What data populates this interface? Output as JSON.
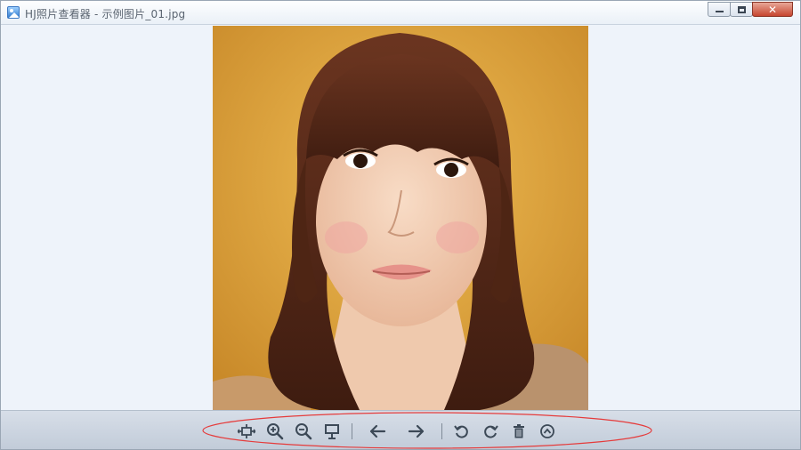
{
  "window": {
    "title": "HJ照片查看器 - 示例图片_01.jpg",
    "close_glyph": "✕"
  },
  "image": {
    "description_icon": "photo-icon"
  },
  "toolbar": {
    "tools": [
      {
        "name": "fit-window-icon"
      },
      {
        "name": "zoom-in-icon"
      },
      {
        "name": "zoom-out-icon"
      },
      {
        "name": "slideshow-icon"
      },
      {
        "name": "previous-icon"
      },
      {
        "name": "next-icon"
      },
      {
        "name": "rotate-left-icon"
      },
      {
        "name": "rotate-right-icon"
      },
      {
        "name": "delete-icon"
      },
      {
        "name": "more-icon"
      }
    ]
  },
  "colors": {
    "annotation": "#e53b3b",
    "icon": "#3c4957",
    "photo_background": "#e0a63c",
    "hair": "#5a2e1a",
    "skin": "#f3d0b5"
  }
}
